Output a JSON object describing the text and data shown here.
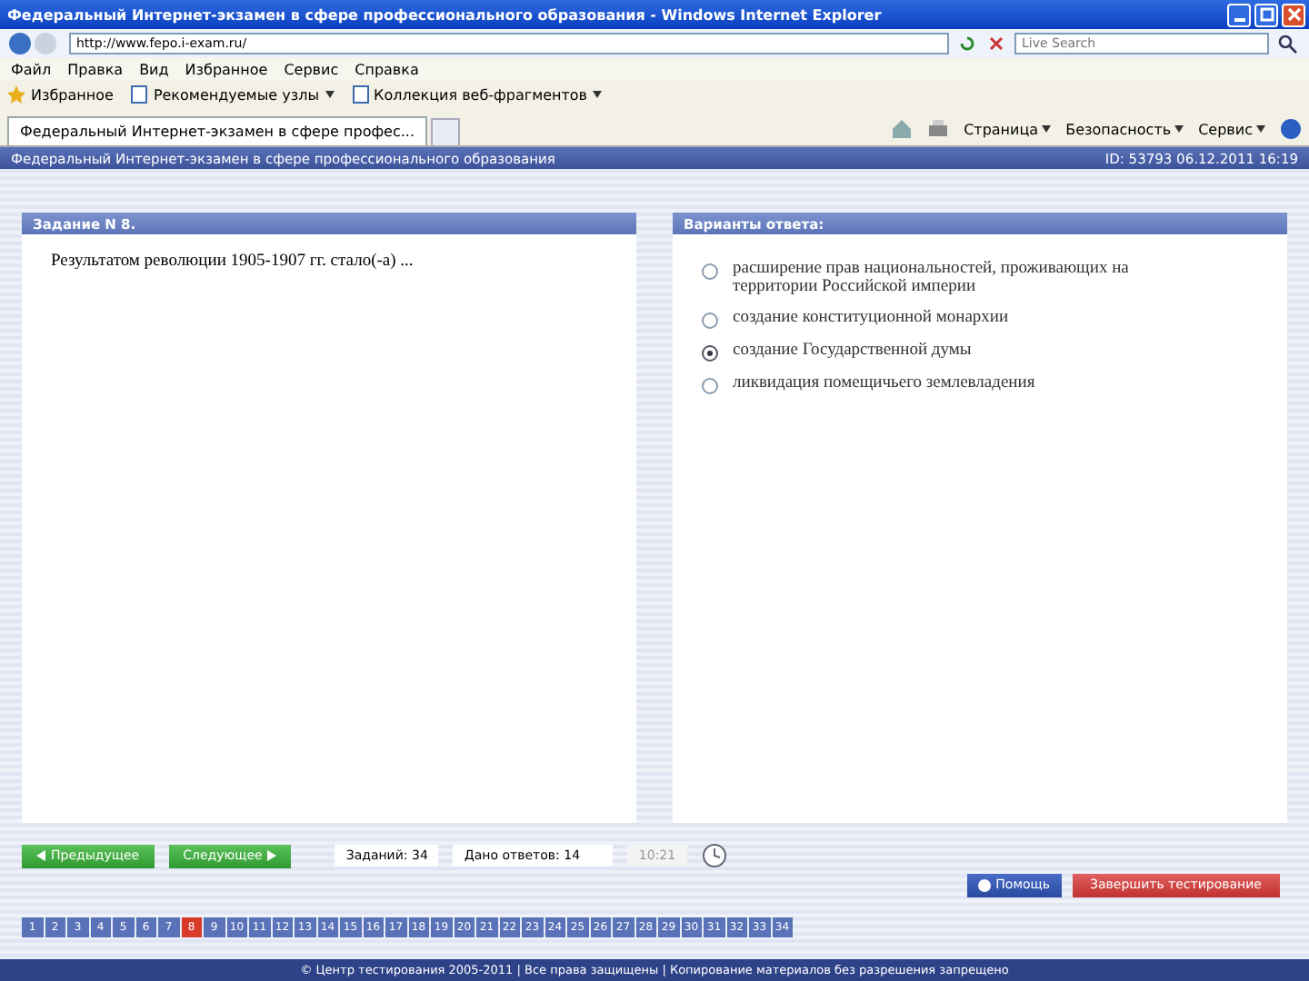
{
  "window": {
    "title": "Федеральный Интернет-экзамен в сфере профессионального образования - Windows Internet Explorer"
  },
  "address": {
    "value": "http://www.fepo.i-exam.ru/"
  },
  "search": {
    "placeholder": "Live Search"
  },
  "menu": [
    "Файл",
    "Правка",
    "Вид",
    "Избранное",
    "Сервис",
    "Справка"
  ],
  "favorites": {
    "label": "Избранное",
    "links": [
      "Рекомендуемые узлы",
      "Коллекция веб-фрагментов"
    ]
  },
  "tab": {
    "title": "Федеральный Интернет-экзамен в сфере профес..."
  },
  "commands": [
    "Страница",
    "Безопасность",
    "Сервис"
  ],
  "page_header": {
    "title": "Федеральный Интернет-экзамен в сфере профессионального образования",
    "info": "ID: 53793 06.12.2011 16:19"
  },
  "task": {
    "heading": "Задание N 8.",
    "question": "Результатом революции 1905-1907 гг. стало(-а) ..."
  },
  "answers": {
    "heading": "Варианты ответа:",
    "options": [
      {
        "text": "расширение прав национальностей, проживающих на территории Российской империи",
        "selected": false
      },
      {
        "text": "создание конституционной монархии",
        "selected": false
      },
      {
        "text": "создание Государственной думы",
        "selected": true
      },
      {
        "text": "ликвидация помещичьего землевладения",
        "selected": false
      }
    ]
  },
  "nav": {
    "prev": "Предыдущее",
    "next": "Следующее",
    "tasks": "Заданий: 34",
    "answered": "Дано ответов: 14",
    "timer": "10:21",
    "help": "Помощь",
    "finish": "Завершить тестирование"
  },
  "pages": [
    {
      "label": "1",
      "selected": false
    },
    {
      "label": "2",
      "selected": false
    },
    {
      "label": "3",
      "selected": false
    },
    {
      "label": "4",
      "selected": false
    },
    {
      "label": "5",
      "selected": false
    },
    {
      "label": "6",
      "selected": false
    },
    {
      "label": "7",
      "selected": false
    },
    {
      "label": "8",
      "selected": true
    },
    {
      "label": "9",
      "selected": false
    },
    {
      "label": "10",
      "selected": false
    },
    {
      "label": "11",
      "selected": false
    },
    {
      "label": "12",
      "selected": false
    },
    {
      "label": "13",
      "selected": false
    },
    {
      "label": "14",
      "selected": false
    },
    {
      "label": "15",
      "selected": false
    },
    {
      "label": "16",
      "selected": false
    },
    {
      "label": "17",
      "selected": false
    },
    {
      "label": "18",
      "selected": false
    },
    {
      "label": "19",
      "selected": false
    },
    {
      "label": "20",
      "selected": false
    },
    {
      "label": "21",
      "selected": false
    },
    {
      "label": "22",
      "selected": false
    },
    {
      "label": "23",
      "selected": false
    },
    {
      "label": "24",
      "selected": false
    },
    {
      "label": "25",
      "selected": false
    },
    {
      "label": "26",
      "selected": false
    },
    {
      "label": "27",
      "selected": false
    },
    {
      "label": "28",
      "selected": false
    },
    {
      "label": "29",
      "selected": false
    },
    {
      "label": "30",
      "selected": false
    },
    {
      "label": "31",
      "selected": false
    },
    {
      "label": "32",
      "selected": false
    },
    {
      "label": "33",
      "selected": false
    },
    {
      "label": "34",
      "selected": false
    }
  ],
  "footer": "© Центр тестирования 2005-2011 | Все права защищены | Копирование материалов без разрешения запрещено"
}
